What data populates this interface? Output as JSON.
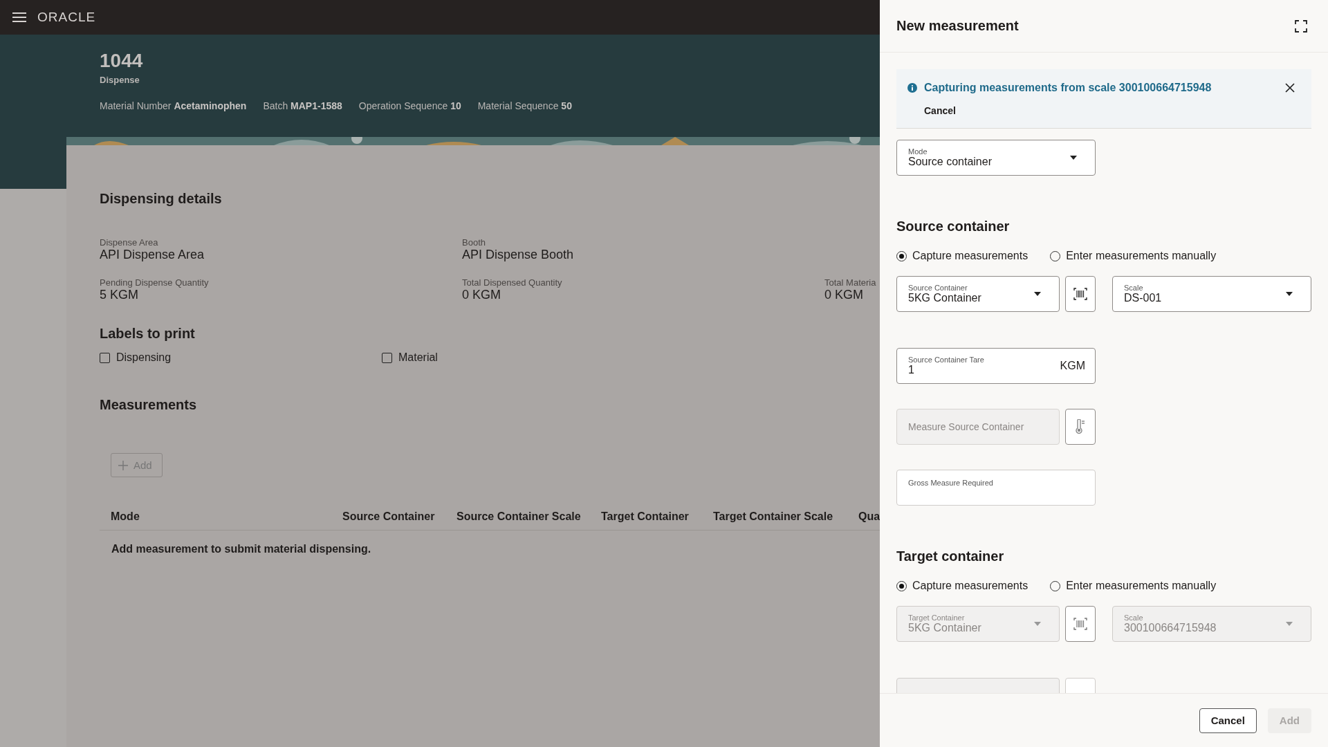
{
  "top_bar": {
    "logo": "ORACLE"
  },
  "header": {
    "title": "1044",
    "subtitle": "Dispense",
    "facts": [
      {
        "label": "Material Number",
        "value": "Acetaminophen"
      },
      {
        "label": "Batch",
        "value": "MAP1-1588"
      },
      {
        "label": "Operation Sequence",
        "value": "10"
      },
      {
        "label": "Material Sequence",
        "value": "50"
      }
    ]
  },
  "dispensing_details": {
    "title": "Dispensing details",
    "fields": [
      {
        "label": "Dispense Area",
        "value": "API Dispense Area"
      },
      {
        "label": "Booth",
        "value": "API Dispense Booth"
      },
      {
        "label": "Pending Dispense Quantity",
        "value": "5 KGM"
      },
      {
        "label": "Total Dispensed Quantity",
        "value": "0 KGM"
      },
      {
        "label": "Total Materia",
        "value": "0 KGM"
      }
    ]
  },
  "labels_to_print": {
    "title": "Labels to print",
    "options": [
      {
        "label": "Dispensing",
        "checked": false
      },
      {
        "label": "Material",
        "checked": false
      }
    ]
  },
  "measurements": {
    "title": "Measurements",
    "add_button": {
      "label": "Add",
      "disabled": true
    },
    "table": {
      "columns": [
        "Mode",
        "Source Container",
        "Source Container Scale",
        "Target Container",
        "Target Container Scale",
        "Qua"
      ],
      "empty_message": "Add measurement to submit material dispensing."
    }
  },
  "drawer": {
    "title": "New measurement",
    "banner": {
      "message": "Capturing measurements from scale 300100664715948",
      "action": "Cancel"
    },
    "mode": {
      "label": "Mode",
      "value": "Source container"
    },
    "source": {
      "title": "Source container",
      "options": [
        {
          "label": "Capture measurements",
          "selected": true
        },
        {
          "label": "Enter measurements manually",
          "selected": false
        }
      ],
      "container": {
        "label": "Source Container",
        "value": "5KG Container",
        "disabled": false
      },
      "scale": {
        "label": "Scale",
        "value": "DS-001",
        "disabled": false
      },
      "tare": {
        "label": "Source Container Tare",
        "value": "1",
        "unit": "KGM"
      },
      "measure_button": {
        "label": "Measure Source Container",
        "disabled": true
      },
      "gross": {
        "label": "Gross Measure Required"
      }
    },
    "target": {
      "title": "Target container",
      "options": [
        {
          "label": "Capture measurements",
          "selected": true
        },
        {
          "label": "Enter measurements manually",
          "selected": false
        }
      ],
      "container": {
        "label": "Target Container",
        "value": "5KG Container",
        "disabled": true
      },
      "scale": {
        "label": "Scale",
        "value": "300100664715948",
        "disabled": true
      }
    },
    "footer": {
      "buttons": [
        {
          "label": "Cancel",
          "disabled": false
        },
        {
          "label": "Add",
          "disabled": true
        }
      ]
    }
  }
}
